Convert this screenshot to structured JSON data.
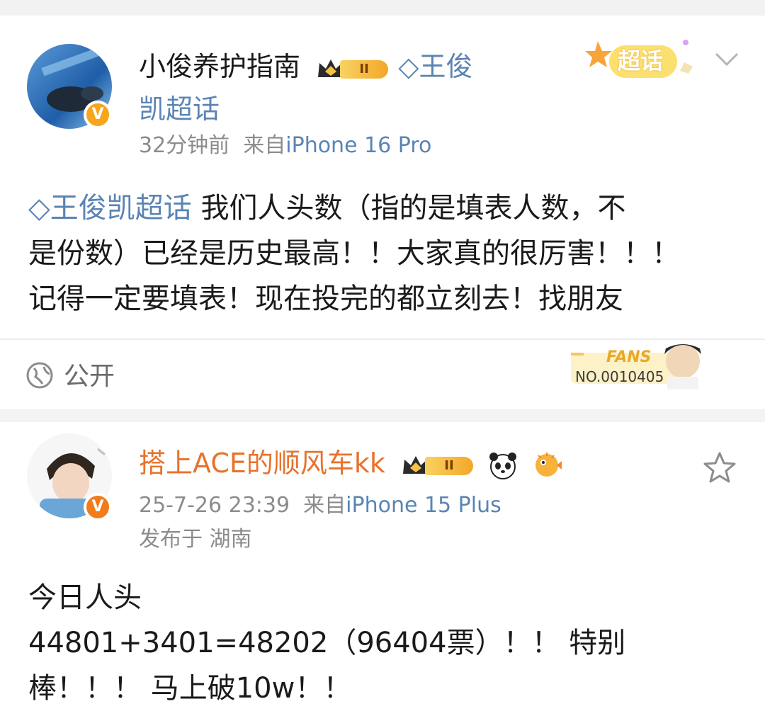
{
  "post1": {
    "username": "小俊养护指南",
    "level": "II",
    "topic_inline": "王俊凯超话",
    "topic_line1": "王俊",
    "topic_line2": "凯超话",
    "time": "32分钟前",
    "source_prefix": "来自",
    "device": "iPhone 16 Pro",
    "chaohua_badge": "超话",
    "body_topic": "王俊凯超话",
    "body_line1": " 我们人头数（指的是填表人数，不",
    "body_line2": "是份数）已经是历史最高！！大家真的很厉害！！！",
    "body_line3": "记得一定要填表！现在投完的都立刻去！找朋友",
    "visibility": "公开",
    "fans_label": "FANS",
    "fans_no": "NO.0010405"
  },
  "post2": {
    "username": "搭上ACE的顺风车kk",
    "level": "II",
    "time": "25-7-26 23:39",
    "source_prefix": "来自",
    "device": "iPhone 15 Plus",
    "location": "发布于 湖南",
    "body_line1": "今日人头",
    "body_line2": "44801+3401=48202（96404票）！！ 特别",
    "body_line3": "棒！！！ 马上破10w！！"
  },
  "colors": {
    "link": "#5a84b4",
    "orange_name": "#e8722c",
    "meta": "#8c8c8c"
  }
}
